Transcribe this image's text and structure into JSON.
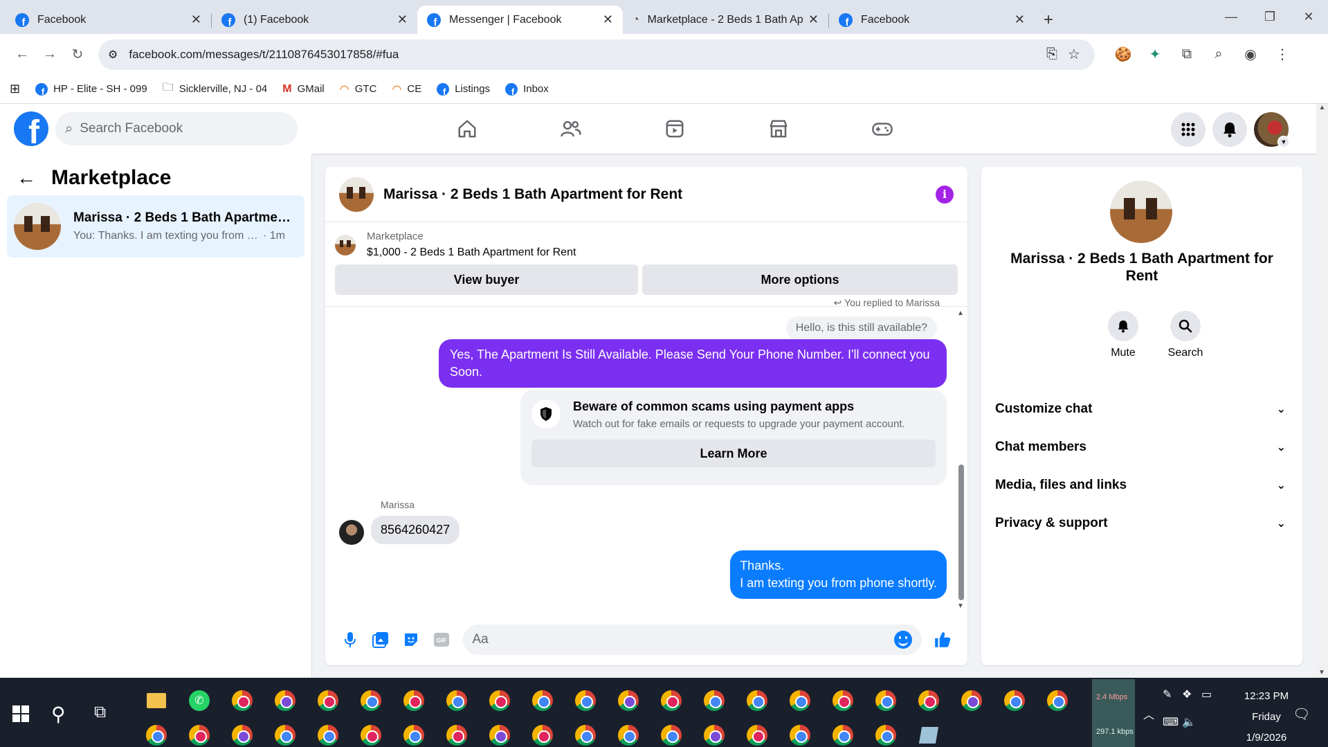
{
  "browser": {
    "tabs": [
      {
        "title": "Facebook",
        "icon": "facebook-icon",
        "active": false
      },
      {
        "title": "(1) Facebook",
        "icon": "facebook-icon",
        "active": false
      },
      {
        "title": "Messenger | Facebook",
        "icon": "facebook-icon",
        "active": true
      },
      {
        "title": "Marketplace - 2 Beds 1 Bath Ap",
        "icon": "loading-icon",
        "active": false
      },
      {
        "title": "Facebook",
        "icon": "facebook-icon",
        "active": false
      }
    ],
    "url": "facebook.com/messages/t/2110876453017858/#fua",
    "bookmarks": [
      {
        "label": "HP - Elite - SH - 099",
        "icon": "facebook-icon"
      },
      {
        "label": "Sicklerville, NJ - 04",
        "icon": "folder-icon"
      },
      {
        "label": "GMail",
        "icon": "gmail-icon"
      },
      {
        "label": "GTC",
        "icon": "rainbow-icon"
      },
      {
        "label": "CE",
        "icon": "rainbow-icon"
      },
      {
        "label": "Listings",
        "icon": "facebook-icon"
      },
      {
        "label": "Inbox",
        "icon": "facebook-icon"
      }
    ]
  },
  "fb": {
    "search_placeholder": "Search Facebook"
  },
  "left": {
    "title": "Marketplace",
    "conversation": {
      "title": "Marissa · 2 Beds 1 Bath Apartment...",
      "preview": "You: Thanks. I am texting you from p...",
      "time": "· 1m"
    }
  },
  "chat": {
    "title": "Marissa · 2 Beds 1 Bath Apartment for Rent",
    "listing_category": "Marketplace",
    "listing_price_title": "$1,000 - 2 Beds 1 Bath Apartment for Rent",
    "view_buyer": "View buyer",
    "more_options": "More options",
    "replied_note": "You replied to Marissa",
    "quoted_message": "Hello, is this still available?",
    "seller_message": "Yes, The Apartment Is Still Available. Please Send Your Phone Number. I'll connect you Soon.",
    "scam_title": "Beware of common scams using payment apps",
    "scam_body": "Watch out for fake emails or requests to upgrade your payment account.",
    "learn_more": "Learn More",
    "buyer_name": "Marissa",
    "buyer_message": "8564260427",
    "reply_line1": "Thanks.",
    "reply_line2": "I am texting you from phone shortly.",
    "composer_placeholder": "Aa"
  },
  "details": {
    "title": "Marissa · 2 Beds 1 Bath Apartment for Rent",
    "mute": "Mute",
    "search": "Search",
    "sections": [
      "Customize chat",
      "Chat members",
      "Media, files and links",
      "Privacy & support"
    ]
  },
  "taskbar": {
    "upload_speed": "2.4 Mbps",
    "download_speed": "297.1 kbps",
    "time": "12:23 PM",
    "day": "Friday",
    "date": "1/9/2026"
  },
  "colors": {
    "fb_blue": "#1877f2",
    "messenger_purple": "#7b2ff0",
    "reply_blue": "#0a7cff",
    "active_convo_bg": "#e7f3ff"
  }
}
